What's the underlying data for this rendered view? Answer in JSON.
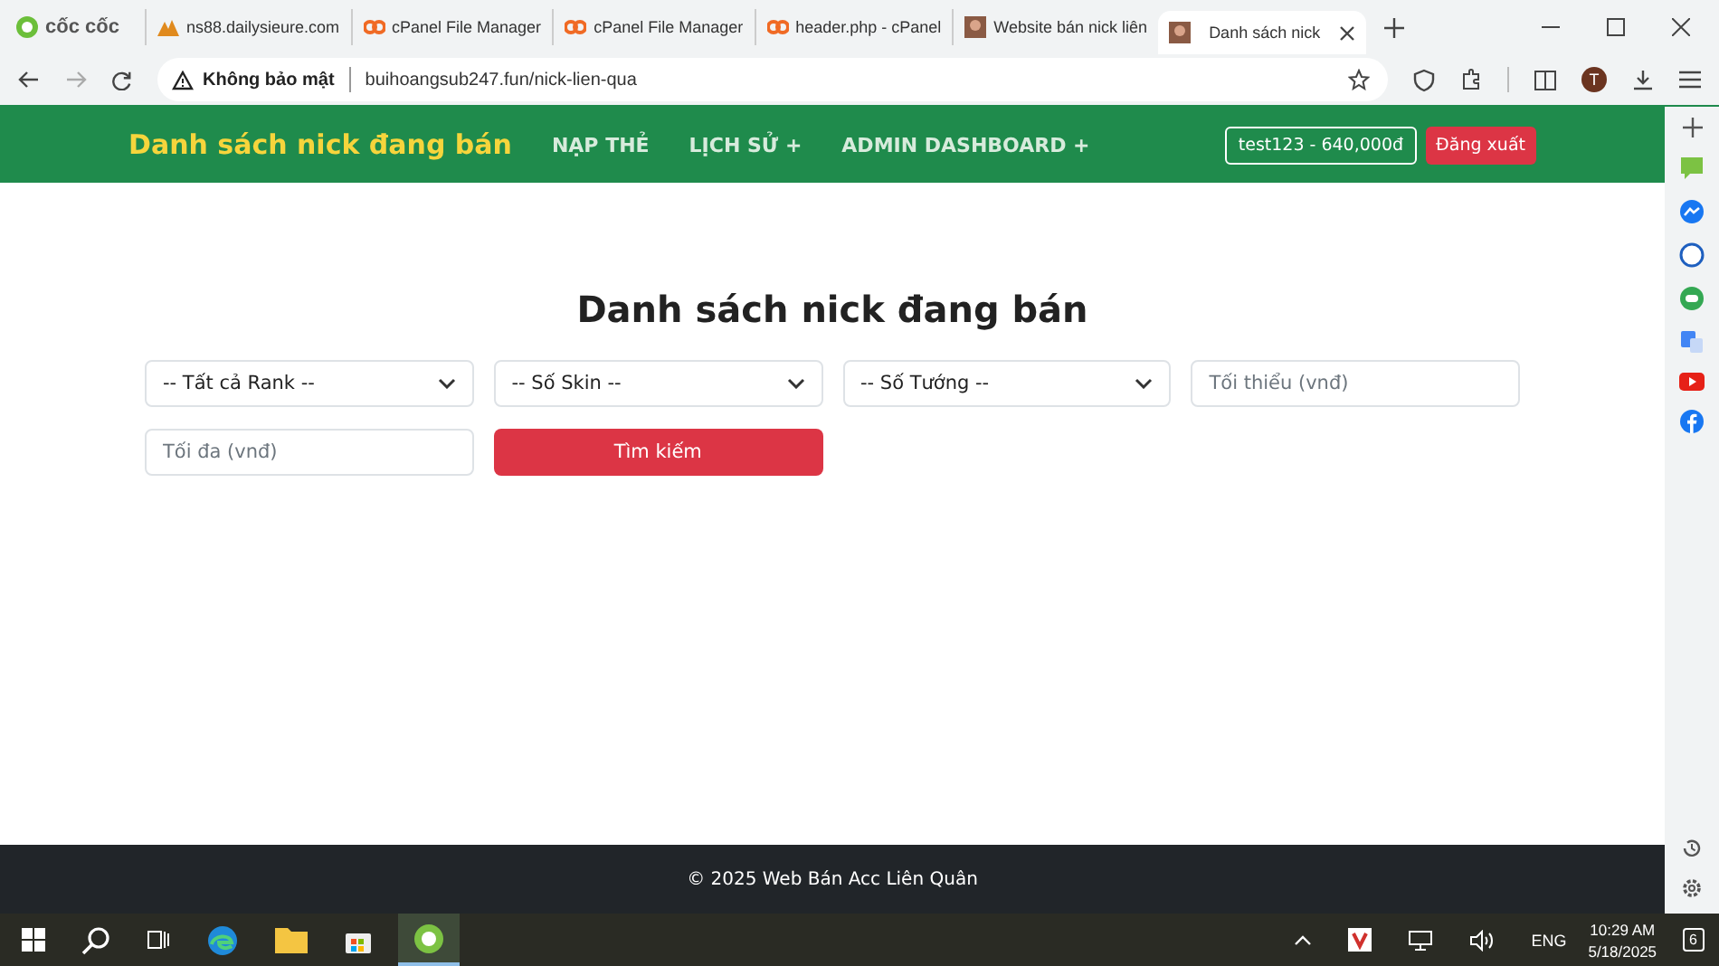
{
  "browser": {
    "brand": "cốc cốc",
    "tabs": [
      {
        "title": "ns88.dailysieure.com",
        "kind": "site",
        "selected": false
      },
      {
        "title": "cPanel File Manager",
        "kind": "cpanel",
        "selected": false
      },
      {
        "title": "cPanel File Manager",
        "kind": "cpanel",
        "selected": false
      },
      {
        "title": "header.php - cPanel",
        "kind": "cpanel",
        "selected": false
      },
      {
        "title": "Website bán nick liên",
        "kind": "photo",
        "selected": false
      },
      {
        "title": "Danh sách nick",
        "kind": "photo",
        "selected": true
      }
    ],
    "security_label": "Không bảo mật",
    "url": "buihoangsub247.fun/nick-lien-qua",
    "profile_initial": "T"
  },
  "navbar": {
    "brand": "Danh sách nick đang bán",
    "links": [
      "NẠP THẺ",
      "LỊCH SỬ +",
      "ADMIN DASHBOARD +"
    ],
    "user": "test123 - 640,000đ",
    "logout": "Đăng xuất"
  },
  "heading": "Danh sách nick đang bán",
  "filters": [
    {
      "kind": "select",
      "value": "-- Tất cả Rank --"
    },
    {
      "kind": "select",
      "value": "-- Số Skin --"
    },
    {
      "kind": "select",
      "value": "-- Số Tướng --"
    },
    {
      "kind": "input",
      "placeholder": "Tối thiểu (vnđ)"
    },
    {
      "kind": "input",
      "placeholder": "Tối đa (vnđ)"
    },
    {
      "kind": "button",
      "label": "Tìm kiếm"
    }
  ],
  "footer": "© 2025 Web Bán Acc Liên Quân",
  "taskbar": {
    "language": "ENG",
    "time": "10:29 AM",
    "date": "5/18/2025",
    "notifications": "6"
  }
}
